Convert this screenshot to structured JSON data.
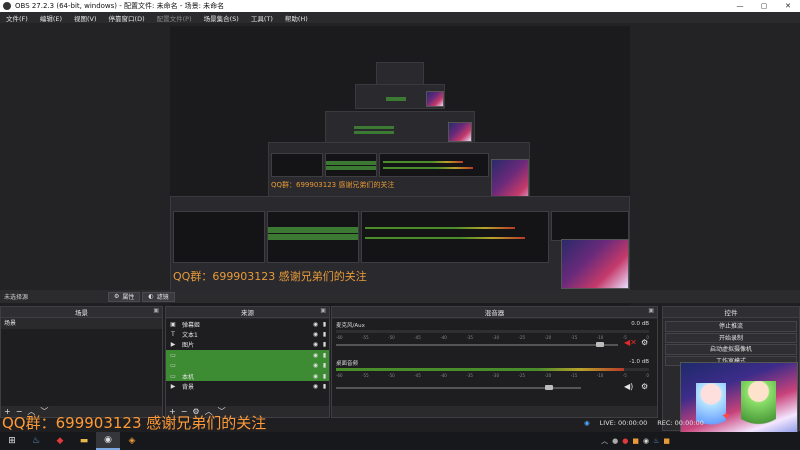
{
  "window": {
    "title": "OBS 27.2.3 (64-bit, windows) - 配置文件: 未命名 - 场景: 未命名",
    "minimize": "—",
    "maximize": "▢",
    "close": "✕"
  },
  "menu": [
    "文件(F)",
    "编辑(E)",
    "视图(V)",
    "停靠窗口(D)",
    "配置文件(P)",
    "场景集合(S)",
    "工具(T)",
    "帮助(H)"
  ],
  "toolbar": {
    "no_source": "未选择源",
    "properties": "属性",
    "filters": "滤镜"
  },
  "preview": {
    "nested_overlay_text": "QQ群：699903123 感谢兄弟们的关注"
  },
  "scenes": {
    "header": "场景",
    "items": [
      "场景"
    ]
  },
  "sources": {
    "header": "来源",
    "items": [
      {
        "name": "弹幕姬",
        "icon": "camera-icon",
        "selected": false
      },
      {
        "name": "文本1",
        "icon": "text-icon",
        "selected": false
      },
      {
        "name": "图片",
        "icon": "play-icon",
        "selected": false
      },
      {
        "name": "",
        "icon": "window-icon",
        "selected": true
      },
      {
        "name": "",
        "icon": "window-icon",
        "selected": true
      },
      {
        "name": "本机",
        "icon": "monitor-icon",
        "selected": true
      },
      {
        "name": "背景",
        "icon": "play-icon",
        "selected": false
      }
    ]
  },
  "mixer": {
    "header": "混音器",
    "channels": [
      {
        "name": "麦克风/Aux",
        "db": "0.0 dB",
        "level": 0.0,
        "fader": 0.95
      },
      {
        "name": "桌面音频",
        "db": "-1.0 dB",
        "level": 0.92,
        "fader": 0.88
      }
    ],
    "ticks": [
      "-60",
      "-55",
      "-50",
      "-45",
      "-40",
      "-35",
      "-30",
      "-25",
      "-20",
      "-15",
      "-10",
      "-5",
      "0"
    ]
  },
  "controls": {
    "header": "控件",
    "buttons": [
      "停止推流",
      "开始录制",
      "启动虚拟摄像机",
      "工作室模式"
    ]
  },
  "status": {
    "live": "LIVE: 00:00:00",
    "rec": "REC: 00:00:00"
  },
  "overlay": {
    "text": "QQ群：699903123 感谢兄弟们的关注",
    "color": "#ff9a36"
  },
  "colors": {
    "selected": "#3d8b33",
    "meter_green": "#4a8c2a",
    "meter_yellow": "#b8a22a",
    "meter_red": "#b83a2a"
  }
}
